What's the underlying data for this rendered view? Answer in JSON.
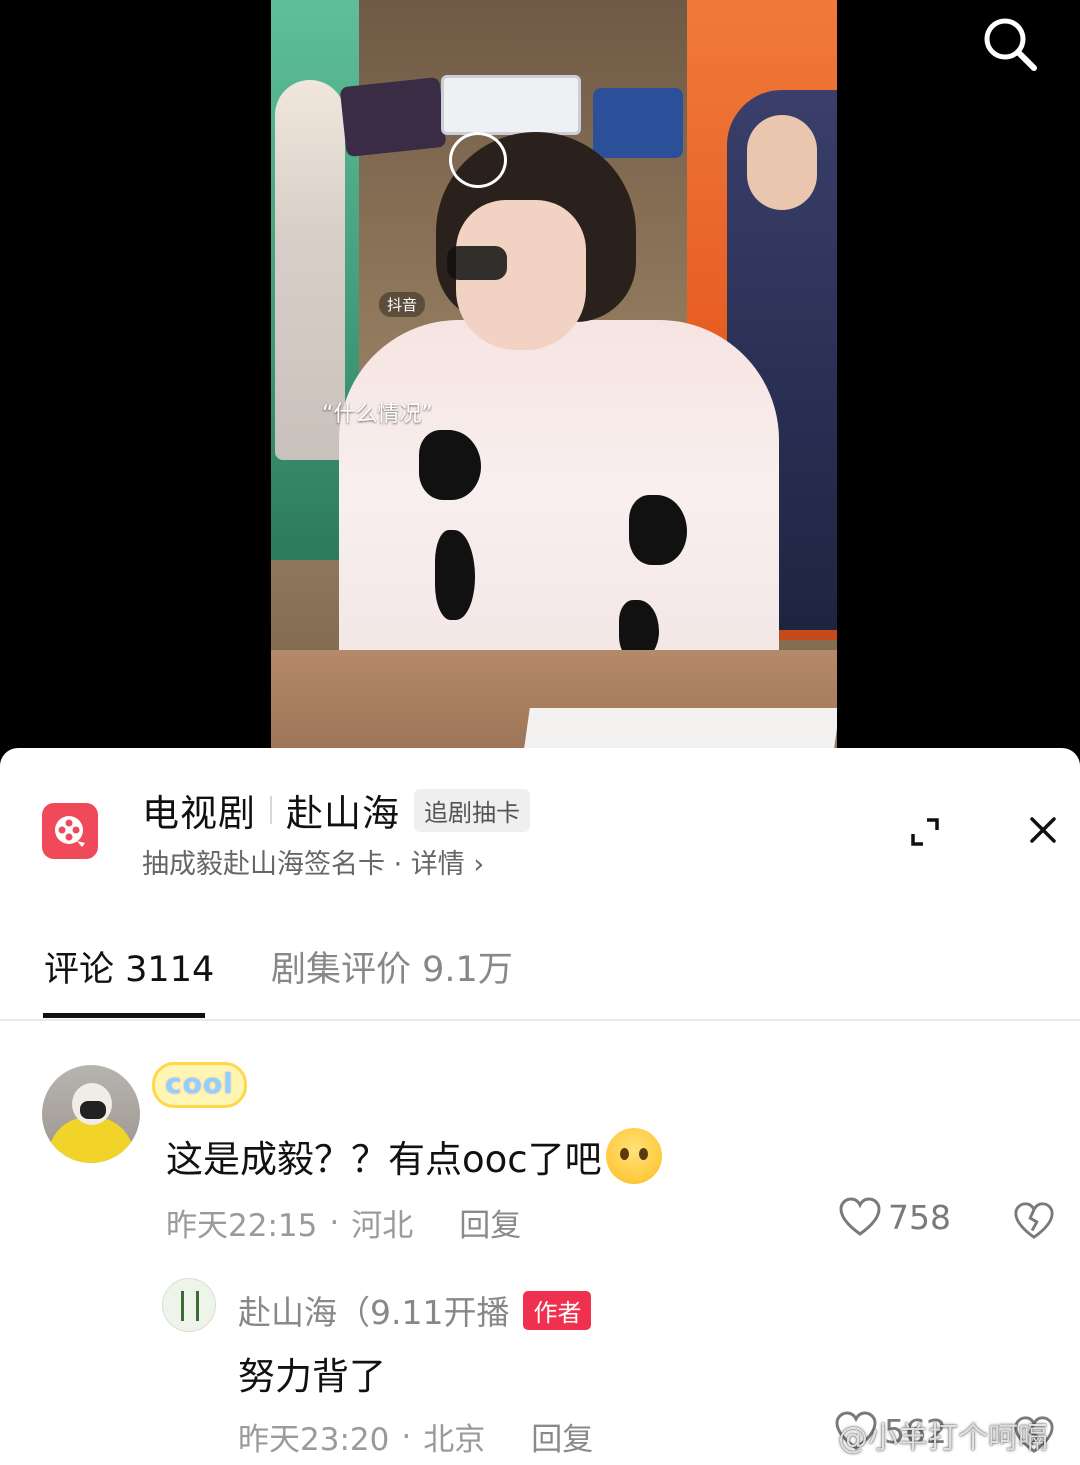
{
  "video": {
    "caption": "“什么情况”",
    "platform_mark": "抖音",
    "search_icon": "search-icon"
  },
  "drama": {
    "category": "电视剧",
    "name": "赴山海",
    "tag": "追剧抽卡",
    "subtitle": "抽成毅赴山海签名卡 · 详情",
    "chevron": "›",
    "icon": "film-reel-icon",
    "accent_color": "#f0495a"
  },
  "tabs": [
    {
      "label": "评论",
      "count": "3114"
    },
    {
      "label": "剧集评价",
      "count": "9.1万"
    }
  ],
  "comments": [
    {
      "badge": "cool",
      "text": "这是成毅？？有点ooc了吧",
      "emoji": "crying-face-emoji",
      "time": "昨天22:15",
      "location": "河北",
      "reply_label": "回复",
      "likes": "758",
      "replies": [
        {
          "name": "赴山海（9.11开播",
          "author_tag": "作者",
          "author_tag_color": "#f0304f",
          "text": "努力背了",
          "time": "昨天23:20",
          "location": "北京",
          "reply_label": "回复",
          "likes": "562"
        }
      ]
    }
  ],
  "watermark": "@小羊打个呵嗝"
}
